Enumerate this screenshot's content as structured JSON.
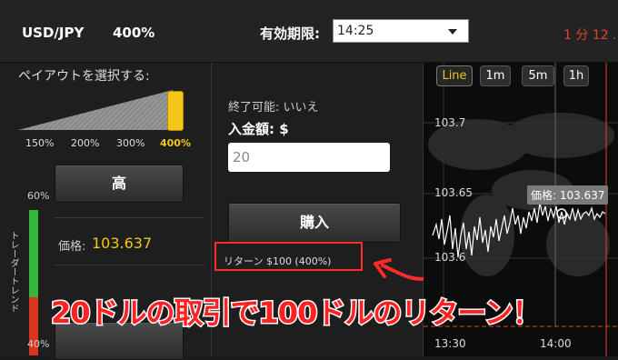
{
  "header": {
    "pair": "USD/JPY",
    "payout": "400%",
    "expiry_label": "有効期限:",
    "expiry_value": "14:25",
    "countdown": "1 分 12 ..."
  },
  "payout_panel": {
    "title": "ペイアウトを選択する:",
    "options": [
      "150%",
      "200%",
      "300%",
      "400%"
    ],
    "selected": "400%",
    "selected_color": "#f5c518"
  },
  "trade_panel": {
    "high_button": "高",
    "trend_top": "60%",
    "trend_bottom": "40%",
    "trend_label": "トレーダートレンド",
    "trend_up_share": 0.6,
    "price_label": "価格:",
    "price_value": "103.637"
  },
  "order_panel": {
    "close_label": "終了可能: いいえ",
    "amount_label": "入金額: $",
    "amount_value": "20",
    "buy_button": "購入",
    "return_text": "リターン $100 (400%)",
    "highlight_color": "#ff2a2a"
  },
  "chart": {
    "timeframes": [
      "Line",
      "1m",
      "5m",
      "1h"
    ],
    "active_timeframe": "Line",
    "price_tag": "価格: 103.637",
    "y_ticks": [
      "103.7",
      "103.65",
      "103.6"
    ],
    "x_ticks": [
      "13:30",
      "14:00"
    ]
  },
  "chart_data": {
    "type": "line",
    "y_ticks": [
      103.7,
      103.65,
      103.6
    ],
    "x_ticks": [
      "13:30",
      "14:00"
    ],
    "current_price": 103.637
  },
  "annotation": {
    "caption": "20ドルの取引で100ドルのリターン！",
    "color": "#ff2222"
  }
}
